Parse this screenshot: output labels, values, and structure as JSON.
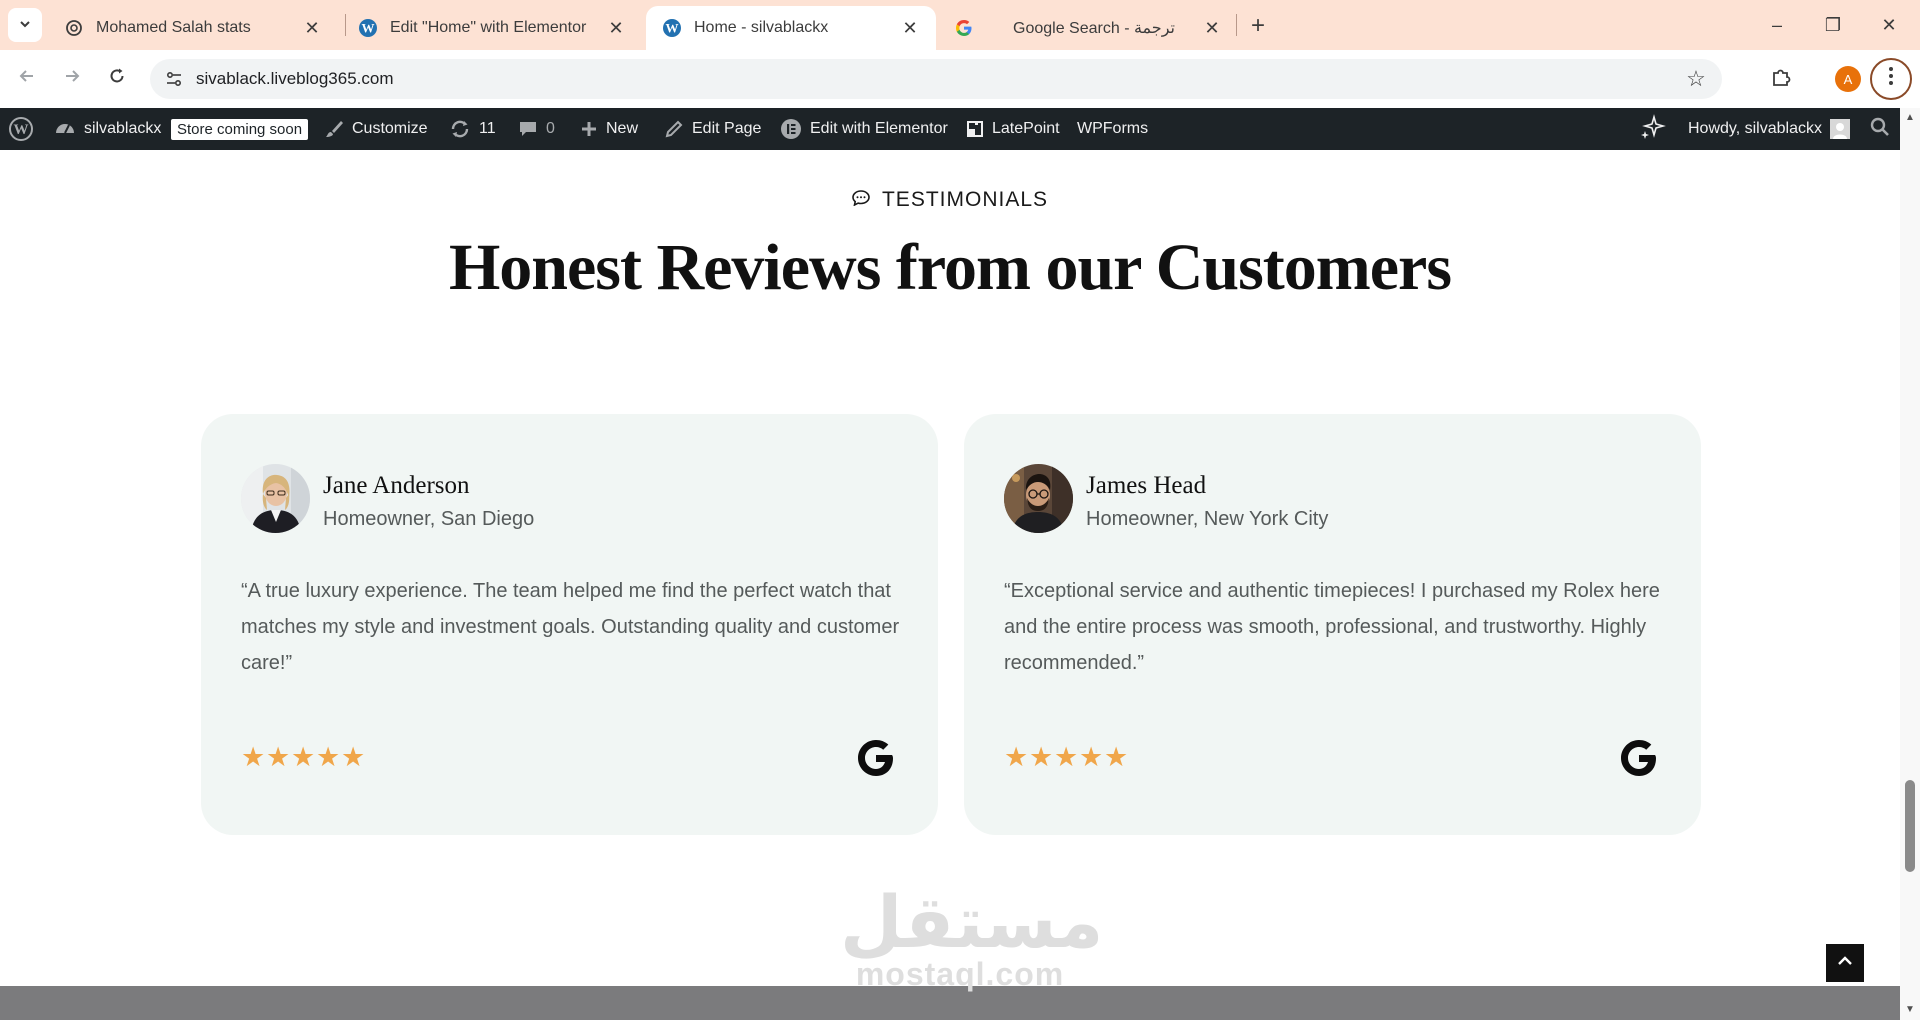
{
  "browser": {
    "tabs": [
      {
        "title": "Mohamed Salah stats",
        "icon": "chatgpt-icon",
        "active": false
      },
      {
        "title": "Edit \"Home\" with Elementor",
        "icon": "wordpress-icon",
        "active": false
      },
      {
        "title": "Home - silvablackx",
        "icon": "wordpress-icon",
        "active": true
      },
      {
        "title": "Google Search - ترجمة",
        "icon": "google-icon",
        "active": false
      }
    ],
    "close_glyph": "✕",
    "new_tab_glyph": "+",
    "url": "sivablack.liveblog365.com",
    "profile_initial": "A",
    "window_controls": {
      "minimize": "–",
      "restore": "❐",
      "close": "✕"
    }
  },
  "admin_bar": {
    "site_name": "silvablackx",
    "store_badge": "Store coming soon",
    "customize": "Customize",
    "updates_count": "11",
    "comments_count": "0",
    "new": "New",
    "edit_page": "Edit Page",
    "edit_elementor": "Edit with Elementor",
    "latepoint": "LatePoint",
    "wpforms": "WPForms",
    "howdy": "Howdy, silvablackx"
  },
  "section": {
    "eyebrow": "TESTIMONIALS",
    "heading": "Honest Reviews from our Customers"
  },
  "testimonials": [
    {
      "name": "Jane Anderson",
      "role": "Homeowner, San Diego",
      "quote": "“A true luxury experience. The team helped me find the perfect watch that matches my style and investment goals. Outstanding quality and customer care!”",
      "rating": 5,
      "source": "google-icon"
    },
    {
      "name": "James Head",
      "role": "Homeowner, New York City",
      "quote": "“Exceptional service and authentic timepieces! I purchased my Rolex here and the entire process was smooth, professional, and trustworthy. Highly recommended.”",
      "rating": 5,
      "source": "google-icon"
    }
  ],
  "watermark": {
    "arabic": "مستقل",
    "latin": "mostaql.com"
  },
  "colors": {
    "tab_strip": "#fde2d4",
    "admin_bar": "#1d2327",
    "card_bg": "#f1f6f4",
    "star": "#f0a64a"
  }
}
